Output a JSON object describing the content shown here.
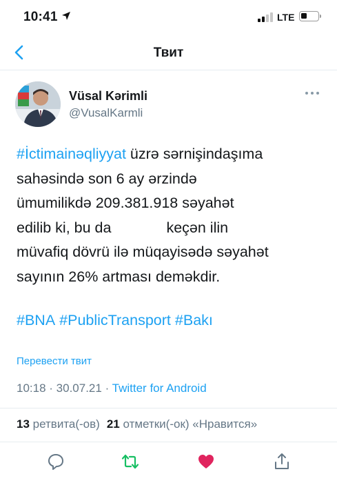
{
  "status_bar": {
    "time": "10:41",
    "network": "LTE"
  },
  "nav": {
    "title": "Твит"
  },
  "author": {
    "name": "Vüsal Kərimli",
    "handle": "@VusalKarmli"
  },
  "tweet": {
    "hashtag_lead": "#İctimainəqliyyat",
    "line1_rest": " üzrə sərnişindaşıma",
    "line2": "sahəsində son 6 ay ərzində",
    "line3": "ümumilikdə 209.381.918 səyahət",
    "line4a": "edilib ki, bu da",
    "line4b": "keçən ilin",
    "line5": "müvafiq dövrü ilə müqayisədə səyahət",
    "line6": "sayının 26% artması deməkdir.",
    "hashtags": [
      "#BNA",
      "#PublicTransport",
      "#Bakı"
    ]
  },
  "translate_link": "Перевести твит",
  "meta": {
    "time": "10:18",
    "separator1": " · ",
    "date": "30.07.21",
    "separator2": " · ",
    "source": "Twitter for Android"
  },
  "stats": {
    "retweets_count": "13",
    "retweets_label": "ретвита(-ов)",
    "likes_count": "21",
    "likes_label": "отметки(-ок) «Нравится»"
  },
  "icons": {
    "reply": "reply-icon",
    "retweet": "retweet-icon",
    "like": "heart-icon",
    "share": "share-icon"
  },
  "colors": {
    "accent": "#1da1f2",
    "retweet": "#17bf63",
    "like": "#e0245e",
    "secondary_text": "#657786"
  }
}
